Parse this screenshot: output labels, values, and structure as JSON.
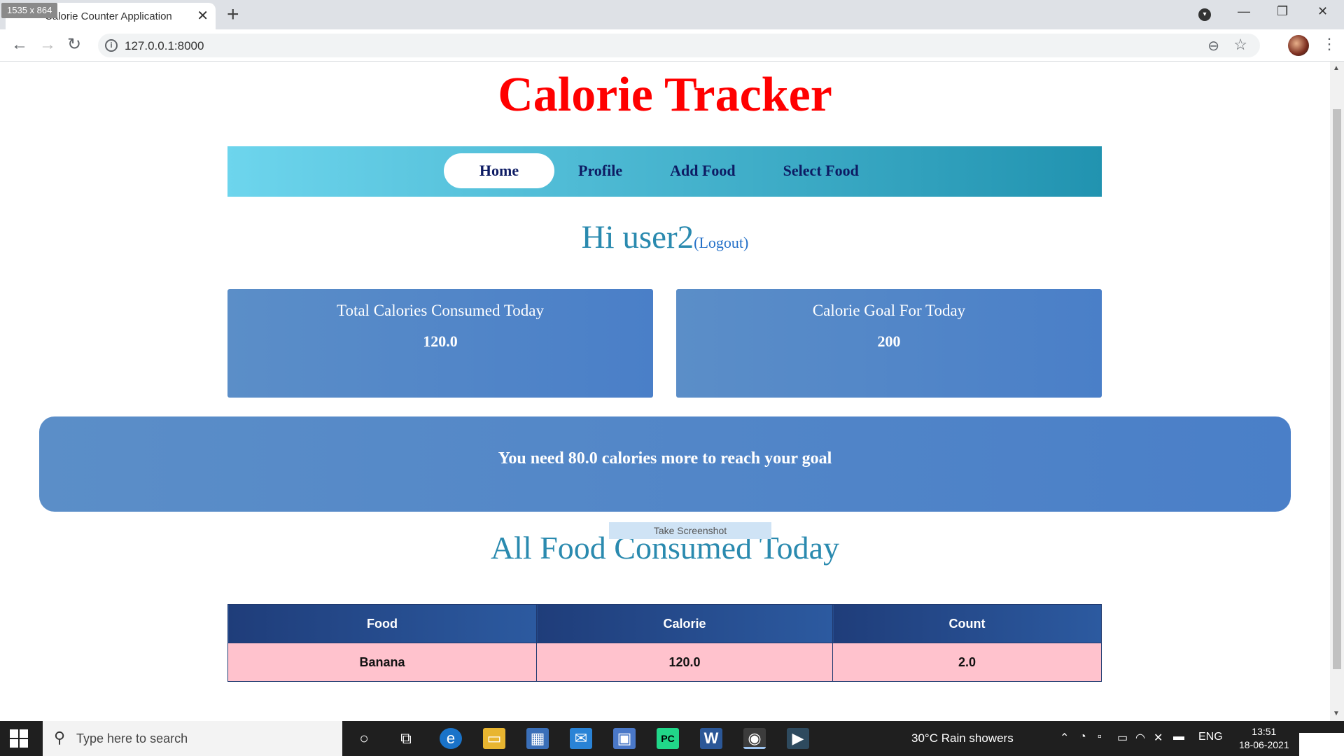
{
  "browser": {
    "size_badge": "1535 x 864",
    "tab_title": "Calorie Counter Application",
    "tab_close": "✕",
    "new_tab": "+",
    "url": "127.0.0.1:8000",
    "back": "←",
    "forward": "→",
    "reload": "↻",
    "minimize": "—",
    "restore": "❐",
    "close": "✕",
    "zoom": "⊖",
    "star": "☆",
    "menu": "⋮"
  },
  "page": {
    "title": "Calorie Tracker",
    "nav": [
      "Home",
      "Profile",
      "Add Food",
      "Select Food"
    ],
    "greeting": "Hi user2",
    "logout": "(Logout)",
    "cards": [
      {
        "label": "Total Calories Consumed Today",
        "value": "120.0"
      },
      {
        "label": "Calorie Goal For Today",
        "value": "200"
      }
    ],
    "goal_message": "You need 80.0 calories more to reach your goal",
    "screenshot_tip": "Take Screenshot",
    "section_title": "All Food Consumed Today",
    "table": {
      "headers": [
        "Food",
        "Calorie",
        "Count"
      ],
      "rows": [
        [
          "Banana",
          "120.0",
          "2.0"
        ]
      ]
    }
  },
  "taskbar": {
    "search_placeholder": "Type here to search",
    "weather": "30°C  Rain showers",
    "language": "ENG",
    "time": "13:51",
    "date": "18-06-2021"
  },
  "colors": {
    "title": "#ff0000",
    "nav_gradient_start": "#6dd5ed",
    "nav_gradient_end": "#2193b0",
    "card_bg": "#4a7fc8",
    "table_header": "#1f3d7a",
    "table_row": "#ffc2cd"
  }
}
